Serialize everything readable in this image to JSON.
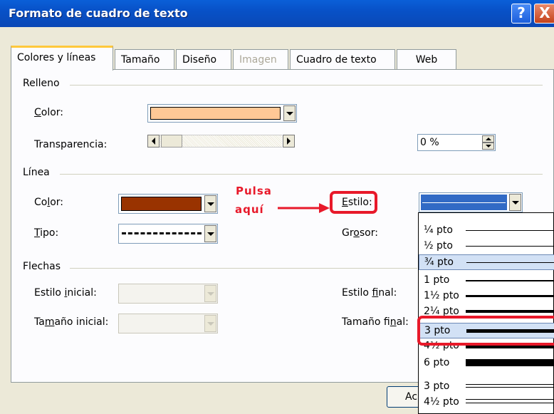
{
  "window": {
    "title": "Formato de cuadro de texto",
    "help_glyph": "?",
    "close_glyph": "X"
  },
  "tabs": [
    {
      "label": "Colores y líneas",
      "active": true
    },
    {
      "label": "Tamaño"
    },
    {
      "label": "Diseño"
    },
    {
      "label": "Imagen",
      "disabled": true
    },
    {
      "label": "Cuadro de texto"
    },
    {
      "label": "Web"
    }
  ],
  "relleno": {
    "heading": "Relleno",
    "color_label": "Color:",
    "color_value": "#ffc896",
    "transparency_label": "Transparencia:",
    "transparency_value": "0 %"
  },
  "linea": {
    "heading": "Línea",
    "color_label": "Color:",
    "color_value": "#993300",
    "tipo_label": "Tipo:",
    "estilo_label": "Estilo:",
    "grosor_label": "Grosor:"
  },
  "flechas": {
    "heading": "Flechas",
    "estilo_inicial_label": "Estilo inicial:",
    "tamano_inicial_label": "Tamaño inicial:",
    "estilo_final_label": "Estilo final:",
    "tamano_final_label": "Tamaño final:"
  },
  "style_options": [
    {
      "label": "¼ pto",
      "weight": 1
    },
    {
      "label": "½ pto",
      "weight": 1
    },
    {
      "label": "¾ pto",
      "weight": 1,
      "selected": true
    },
    {
      "label": "1 pto",
      "weight": 2
    },
    {
      "label": "1½ pto",
      "weight": 3
    },
    {
      "label": "2¼ pto",
      "weight": 4
    },
    {
      "label": "3 pto",
      "weight": 5
    },
    {
      "label": "4½ pto",
      "weight": 7
    },
    {
      "label": "6 pto",
      "weight": 10
    },
    {
      "label": "3 pto",
      "double": true
    },
    {
      "label": "4½ pto",
      "double": true
    }
  ],
  "annotation": {
    "line1": "Pulsa",
    "line2": "aquí",
    "color": "#e8192a"
  },
  "bottom_button_label": "Ac"
}
